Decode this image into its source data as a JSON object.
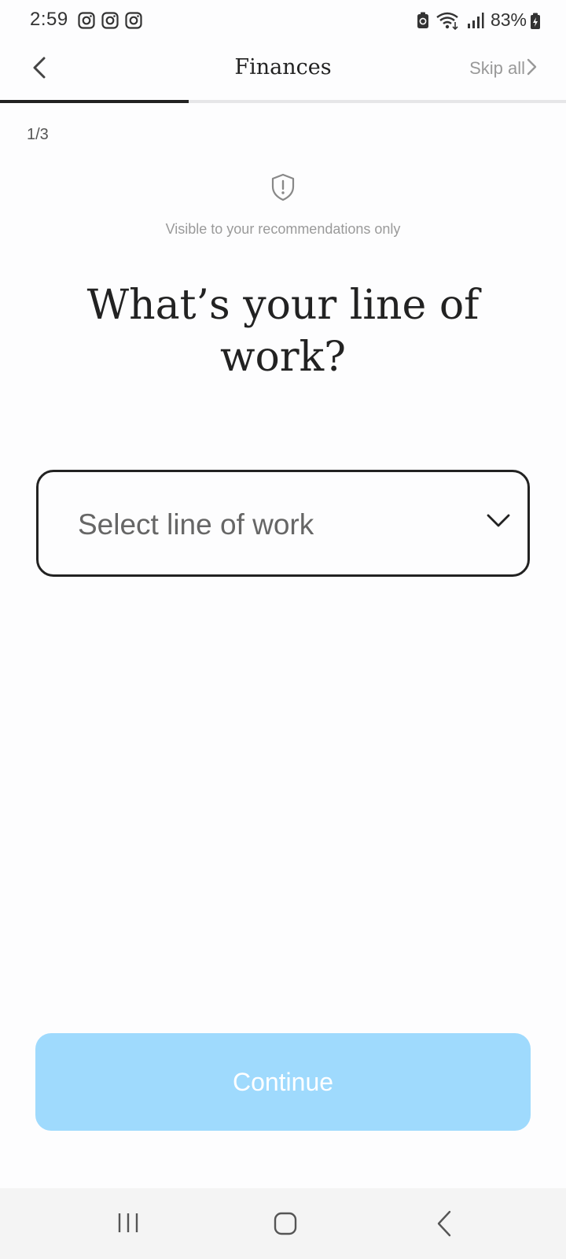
{
  "status_bar": {
    "time": "2:59",
    "notification_icons": [
      "instagram-icon",
      "instagram-icon",
      "instagram-icon"
    ],
    "battery_percent": "83%",
    "icons": [
      "battery-saver-icon",
      "wifi-icon",
      "signal-icon",
      "battery-charging-icon"
    ]
  },
  "header": {
    "title": "Finances",
    "skip_label": "Skip all",
    "back_icon": "chevron-left-icon",
    "skip_icon": "chevron-right-icon"
  },
  "progress": {
    "fraction": 0.333
  },
  "step": {
    "label": "1/3"
  },
  "privacy": {
    "icon": "shield-alert-icon",
    "text": "Visible to your recommendations only"
  },
  "question": {
    "title": "What’s your line of work?"
  },
  "select": {
    "placeholder": "Select line of work",
    "icon": "chevron-down-icon"
  },
  "continue_button": {
    "label": "Continue",
    "color": "#9fdafd"
  },
  "nav_bar": {
    "icons": [
      "recents-icon",
      "home-icon",
      "back-icon"
    ]
  },
  "colors": {
    "background": "#fdfdfe",
    "text": "#222222",
    "muted": "#999999",
    "accent": "#9fdafd"
  }
}
